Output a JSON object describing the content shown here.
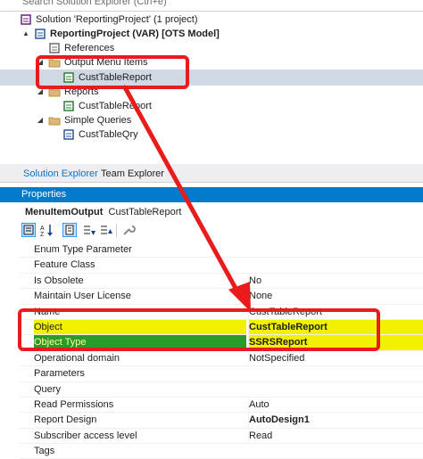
{
  "search": {
    "placeholder": "Search Solution Explorer (Ctrl+é)"
  },
  "tree": [
    {
      "label": "Solution 'ReportingProject' (1 project)",
      "indent": 0,
      "expander": "",
      "icon": "solution-icon",
      "bold": false
    },
    {
      "label": "ReportingProject (VAR) [OTS Model]",
      "indent": 1,
      "expander": "▲",
      "icon": "project-icon",
      "bold": true
    },
    {
      "label": "References",
      "indent": 2,
      "expander": "",
      "icon": "references-icon",
      "bold": false
    },
    {
      "label": "Output Menu Items",
      "indent": 2,
      "expander": "◢",
      "icon": "folder-icon",
      "bold": false
    },
    {
      "label": "CustTableReport",
      "indent": 3,
      "expander": "",
      "icon": "menu-item-icon",
      "bold": false,
      "selected": true
    },
    {
      "label": "Reports",
      "indent": 2,
      "expander": "◢",
      "icon": "folder-icon",
      "bold": false
    },
    {
      "label": "CustTableReport",
      "indent": 3,
      "expander": "",
      "icon": "report-icon",
      "bold": false
    },
    {
      "label": "Simple Queries",
      "indent": 2,
      "expander": "◢",
      "icon": "folder-icon",
      "bold": false
    },
    {
      "label": "CustTableQry",
      "indent": 3,
      "expander": "",
      "icon": "query-icon",
      "bold": false
    }
  ],
  "tabs": [
    {
      "label": "Solution Explorer",
      "active": true
    },
    {
      "label": "Team Explorer",
      "active": false
    }
  ],
  "properties": {
    "title": "Properties",
    "object_type": "MenuItemOutput",
    "object_name": "CustTableReport",
    "rows": [
      {
        "name": "Enum Type Parameter",
        "value": ""
      },
      {
        "name": "Feature Class",
        "value": ""
      },
      {
        "name": "Is Obsolete",
        "value": "No"
      },
      {
        "name": "Maintain User License",
        "value": "None"
      },
      {
        "name": "Name",
        "value": "CustTableReport"
      },
      {
        "name": "Object",
        "value": "CustTableReport",
        "bold": true,
        "highlight": "yellow"
      },
      {
        "name": "Object Type",
        "value": "SSRSReport",
        "bold": true,
        "highlight": "green"
      },
      {
        "name": "Operational domain",
        "value": "NotSpecified"
      },
      {
        "name": "Parameters",
        "value": ""
      },
      {
        "name": "Query",
        "value": ""
      },
      {
        "name": "Read Permissions",
        "value": "Auto"
      },
      {
        "name": "Report Design",
        "value": "AutoDesign1",
        "bold": true
      },
      {
        "name": "Subscriber access level",
        "value": "Read"
      },
      {
        "name": "Tags",
        "value": ""
      }
    ]
  },
  "colors": {
    "accent": "#007acc",
    "annotation_red": "#ea1b1b",
    "highlight_yellow": "#f2f200",
    "highlight_green": "#2a9a2a"
  }
}
